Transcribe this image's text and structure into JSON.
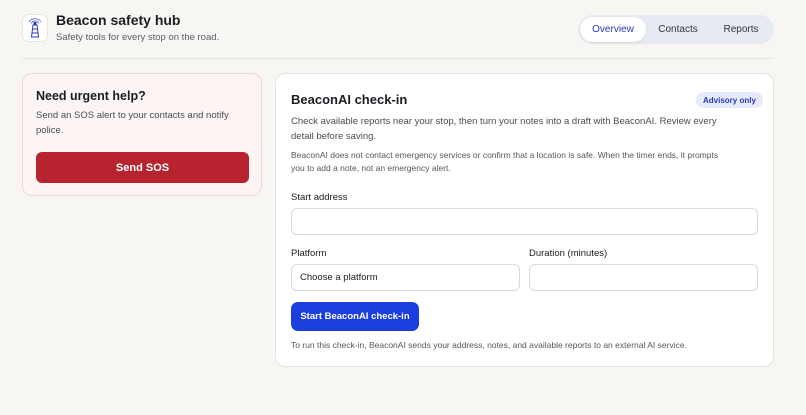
{
  "app": {
    "title": "Beacon safety hub",
    "subtitle": "Safety tools for every stop on the road.",
    "logo_icon": "lighthouse-icon"
  },
  "nav": {
    "tabs": [
      {
        "label": "Overview",
        "active": true
      },
      {
        "label": "Contacts",
        "active": false
      },
      {
        "label": "Reports",
        "active": false
      }
    ]
  },
  "sos": {
    "title": "Need urgent help?",
    "description": "Send an SOS alert to your contacts and notify police.",
    "button_label": "Send SOS"
  },
  "checkin": {
    "title": "BeaconAI check-in",
    "badge": "Advisory only",
    "description": "Check available reports near your stop, then turn your notes into a draft with BeaconAI. Review every detail before saving.",
    "note": "BeaconAI does not contact emergency services or confirm that a location is safe. When the timer ends, it prompts you to add a note, not an emergency alert.",
    "start_address_label": "Start address",
    "start_address_value": "",
    "platform_label": "Platform",
    "platform_selected": "Choose a platform",
    "duration_label": "Duration (minutes)",
    "duration_value": "",
    "start_button_label": "Start BeaconAI check-in",
    "footer": "To run this check-in, BeaconAI sends your address, notes, and available reports to an external AI service."
  },
  "colors": {
    "sos_red": "#b82330",
    "primary_blue": "#1b3fdc",
    "accent_blue": "#2a39b8",
    "background": "#f7f6f3"
  }
}
